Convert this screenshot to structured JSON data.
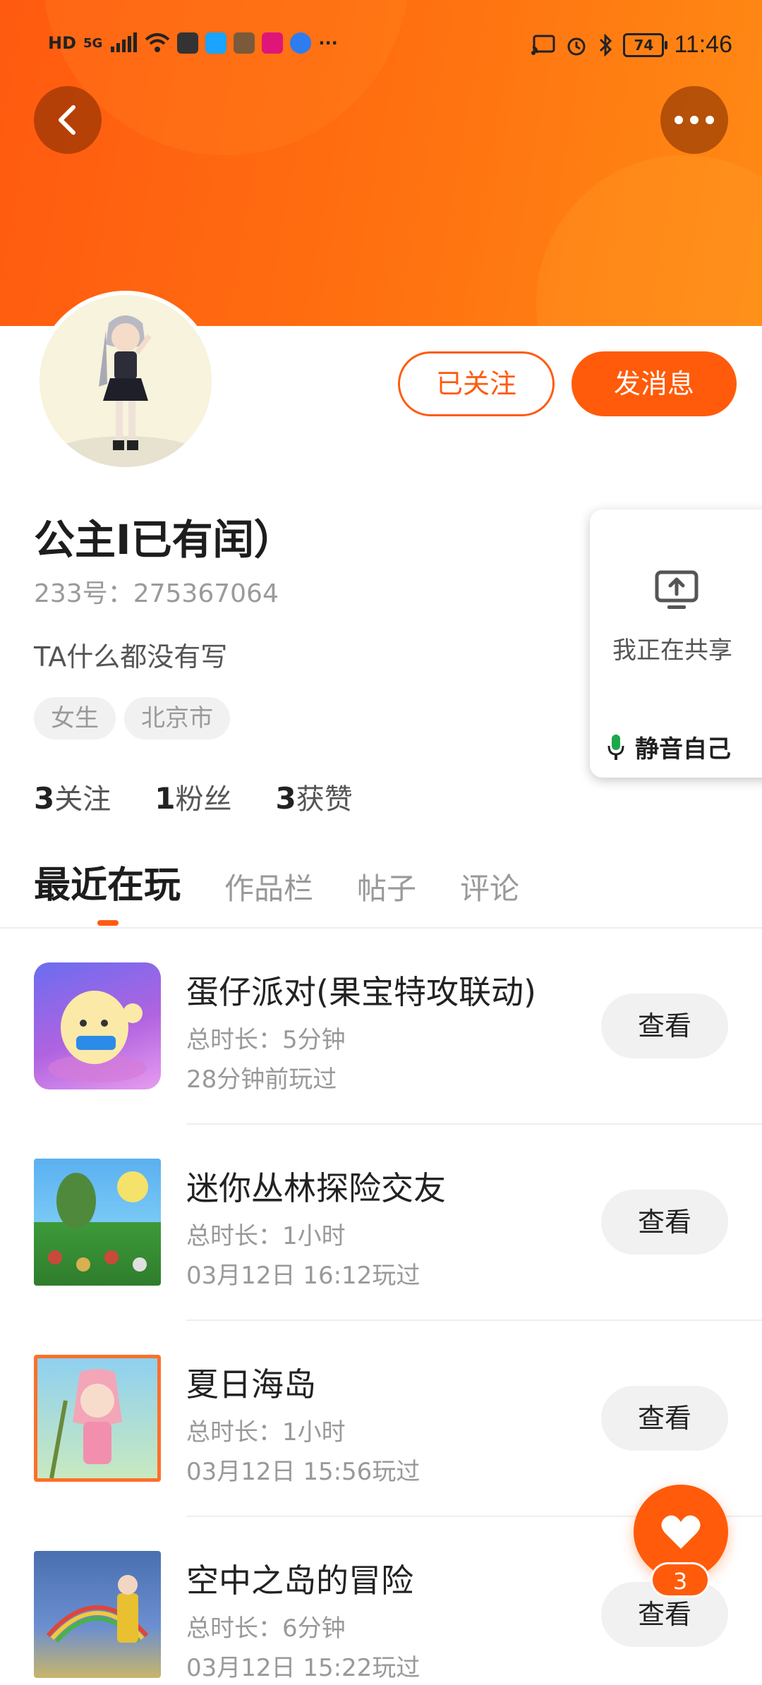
{
  "status_bar": {
    "left_text": "HD",
    "network": "5G",
    "more_indicator": "···",
    "battery": "74",
    "time": "11:46"
  },
  "header": {
    "back_icon": "chevron-left-icon",
    "more_icon": "more-dots-icon",
    "colors": {
      "gradient_start": "#ff5a10",
      "gradient_end": "#ff8a14"
    }
  },
  "profile": {
    "username": "公主I已有闰）",
    "id_label": "233号：275367064",
    "bio": "TA什么都没有写",
    "tags": [
      "女生",
      "北京市"
    ],
    "follow_button": "已关注",
    "message_button": "发消息",
    "stats": [
      {
        "count": "3",
        "label": "关注"
      },
      {
        "count": "1",
        "label": "粉丝"
      },
      {
        "count": "3",
        "label": "获赞"
      }
    ]
  },
  "screen_share": {
    "label": "我正在共享",
    "mute_label": "静音自己"
  },
  "tabs": [
    {
      "label": "最近在玩",
      "active": true
    },
    {
      "label": "作品栏",
      "active": false
    },
    {
      "label": "帖子",
      "active": false
    },
    {
      "label": "评论",
      "active": false
    }
  ],
  "games": [
    {
      "title": "蛋仔派对(果宝特攻联动)",
      "duration": "总时长：5分钟",
      "last_played": "28分钟前玩过",
      "button": "查看"
    },
    {
      "title": "迷你丛林探险交友",
      "duration": "总时长：1小时",
      "last_played": "03月12日 16:12玩过",
      "button": "查看"
    },
    {
      "title": "夏日海岛",
      "duration": "总时长：1小时",
      "last_played": "03月12日 15:56玩过",
      "button": "查看"
    },
    {
      "title": "空中之岛的冒险",
      "duration": "总时长：6分钟",
      "last_played": "03月12日 15:22玩过",
      "button": "查看"
    }
  ],
  "like": {
    "icon": "heart-icon",
    "count": "3"
  },
  "accent_color": "#ff5b0a"
}
